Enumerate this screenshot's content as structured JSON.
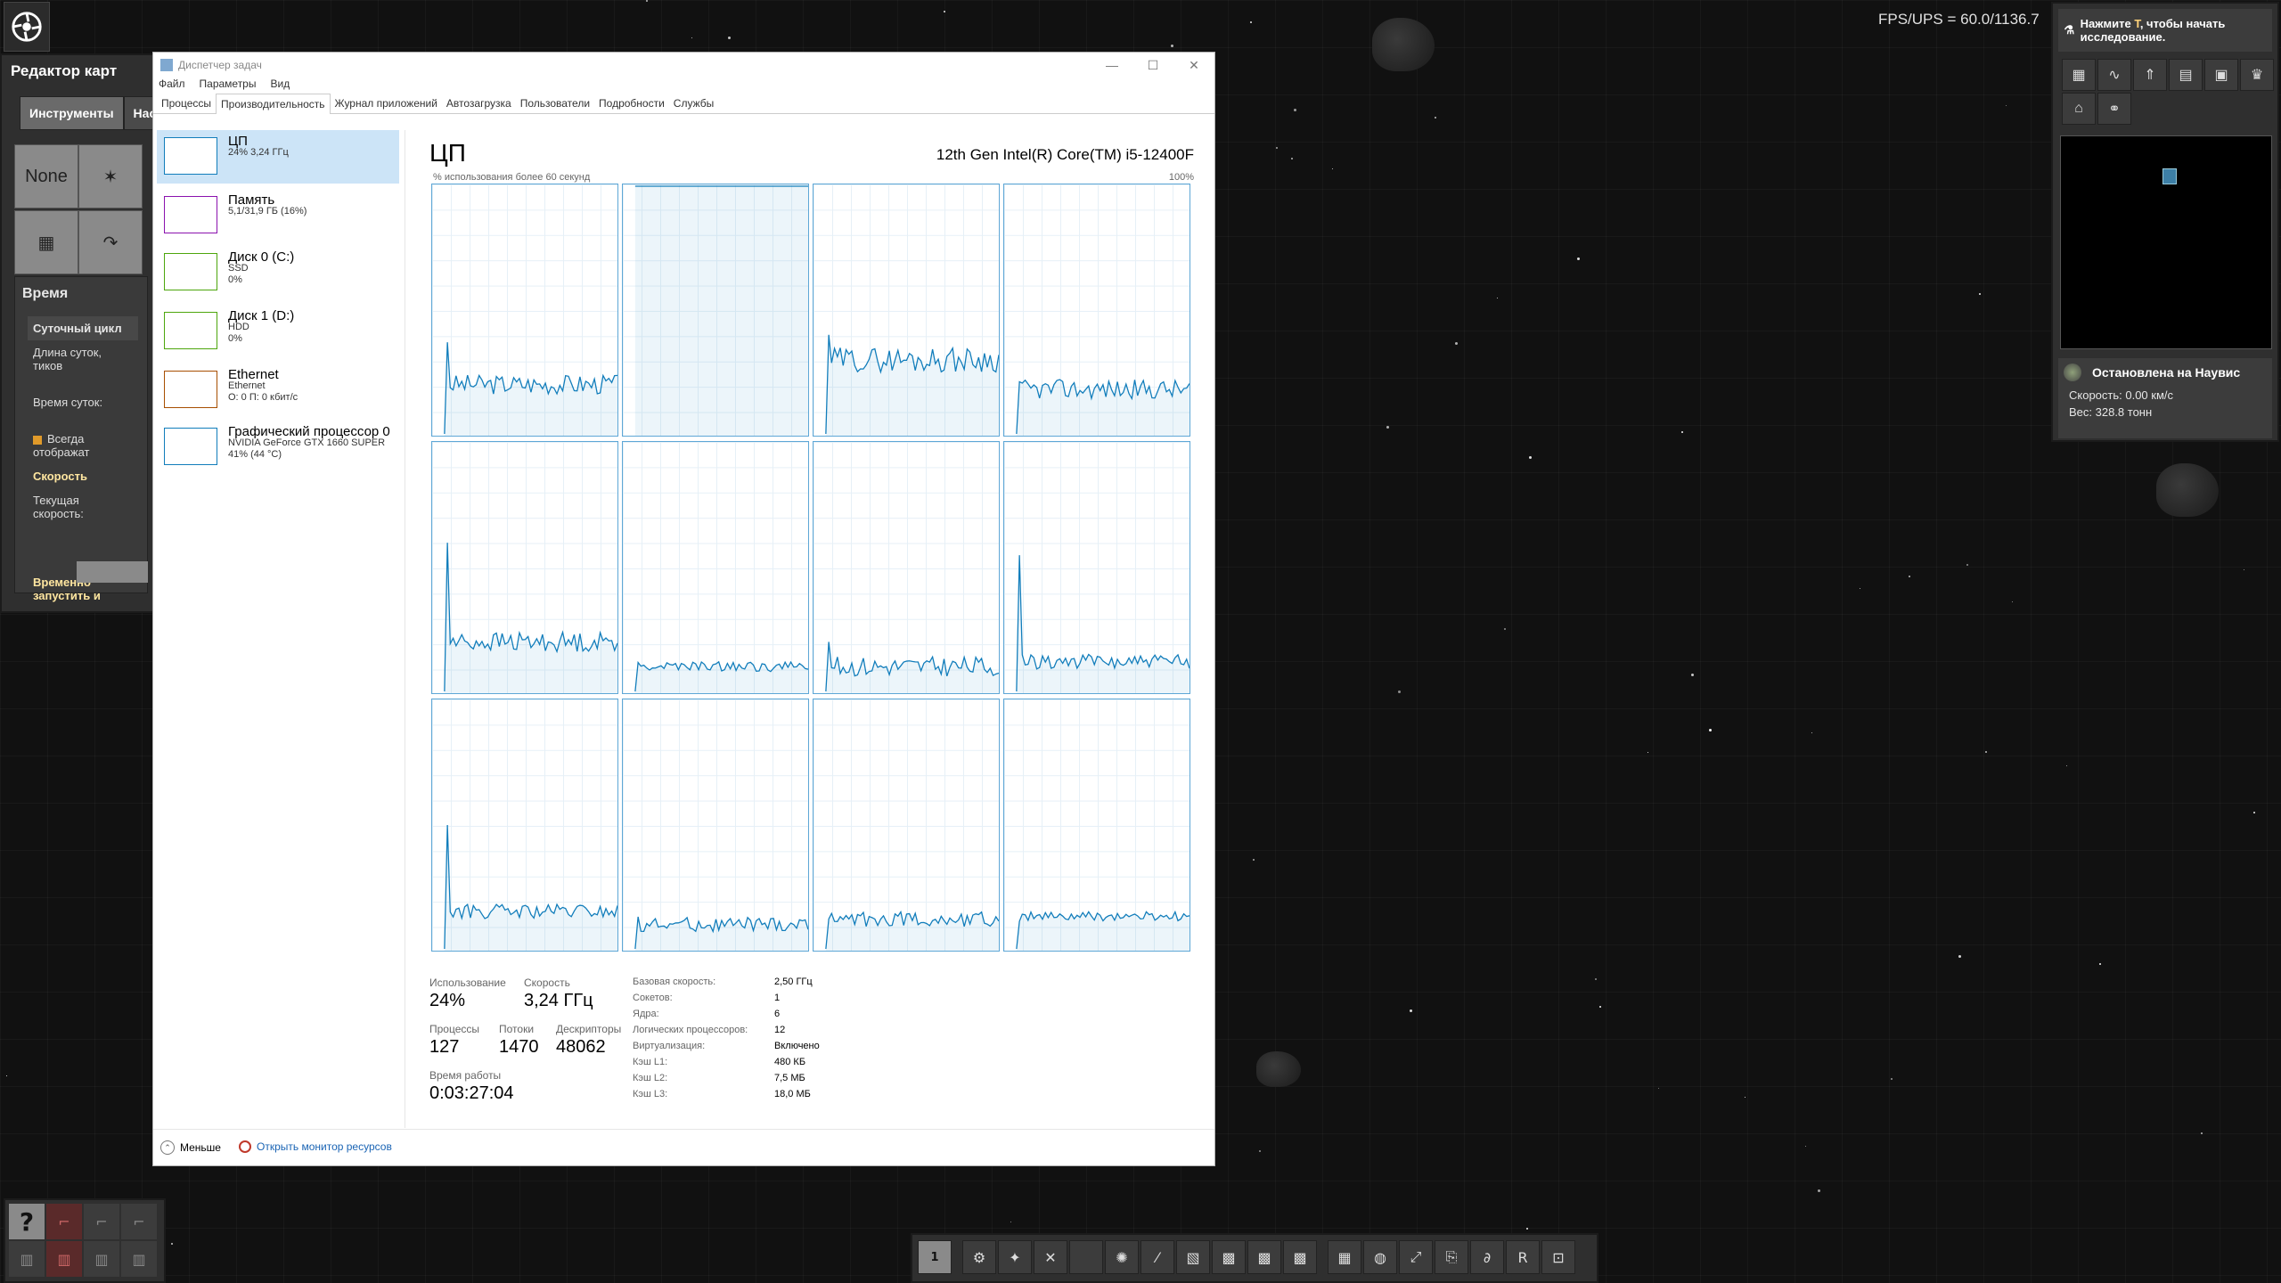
{
  "hud": {
    "fps": "FPS/UPS = 60.0/1136.7"
  },
  "map_editor": {
    "title": "Редактор карт",
    "tabs": [
      "Инструменты",
      "Настр"
    ],
    "tool_none": "None",
    "section_title": "Время",
    "day_cycle": "Суточный цикл",
    "day_length": "Длина суток, тиков",
    "time_of_day": "Время суток:",
    "always_show": "Всегда отображат",
    "speed": "Скорость",
    "current_speed": "Текущая скорость:",
    "temp_run": "Временно запустить и"
  },
  "task_manager": {
    "title": "Диспетчер задач",
    "menu": [
      "Файл",
      "Параметры",
      "Вид"
    ],
    "tabs": [
      "Процессы",
      "Производительность",
      "Журнал приложений",
      "Автозагрузка",
      "Пользователи",
      "Подробности",
      "Службы"
    ],
    "active_tab": "Производительность",
    "sidebar": [
      {
        "name": "ЦП",
        "sub1": "24% 3,24 ГГц",
        "sub2": "",
        "sub3": "",
        "color": "#117dbb"
      },
      {
        "name": "Память",
        "sub1": "5,1/31,9 ГБ (16%)",
        "sub2": "",
        "sub3": "",
        "color": "#8b12ae"
      },
      {
        "name": "Диск 0 (C:)",
        "sub1": "SSD",
        "sub2": "0%",
        "sub3": "",
        "color": "#4da60c"
      },
      {
        "name": "Диск 1 (D:)",
        "sub1": "HDD",
        "sub2": "0%",
        "sub3": "",
        "color": "#4da60c"
      },
      {
        "name": "Ethernet",
        "sub1": "Ethernet",
        "sub2": "О: 0 П: 0 кбит/с",
        "sub3": "",
        "color": "#a74f01"
      },
      {
        "name": "Графический процессор 0",
        "sub1": "NVIDIA GeForce GTX 1660 SUPER",
        "sub2": "41% (44 °C)",
        "sub3": "",
        "color": "#117dbb"
      }
    ],
    "cpu": {
      "title": "ЦП",
      "model": "12th Gen Intel(R) Core(TM) i5-12400F",
      "axis_left": "% использования более 60 секунд",
      "axis_right": "100%",
      "usage_label": "Использование",
      "usage_value": "24%",
      "speed_label": "Скорость",
      "speed_value": "3,24 ГГц",
      "processes_label": "Процессы",
      "processes_value": "127",
      "threads_label": "Потоки",
      "threads_value": "1470",
      "handles_label": "Дескрипторы",
      "handles_value": "48062",
      "uptime_label": "Время работы",
      "uptime_value": "0:03:27:04",
      "details": [
        {
          "k": "Базовая скорость:",
          "v": "2,50 ГГц"
        },
        {
          "k": "Сокетов:",
          "v": "1"
        },
        {
          "k": "Ядра:",
          "v": "6"
        },
        {
          "k": "Логических процессоров:",
          "v": "12"
        },
        {
          "k": "Виртуализация:",
          "v": "Включено"
        },
        {
          "k": "Кэш L1:",
          "v": "480 КБ"
        },
        {
          "k": "Кэш L2:",
          "v": "7,5 МБ"
        },
        {
          "k": "Кэш L3:",
          "v": "18,0 МБ"
        }
      ],
      "core_traces": [
        {
          "spike": 0.37,
          "base": 0.2,
          "noise": 0.04,
          "full": false
        },
        {
          "spike": 0.0,
          "base": 1.0,
          "noise": 0.0,
          "full": true
        },
        {
          "spike": 0.4,
          "base": 0.3,
          "noise": 0.05,
          "full": false
        },
        {
          "spike": 0.0,
          "base": 0.18,
          "noise": 0.04,
          "full": false
        },
        {
          "spike": 0.6,
          "base": 0.2,
          "noise": 0.04,
          "full": false
        },
        {
          "spike": 0.0,
          "base": 0.1,
          "noise": 0.02,
          "full": false
        },
        {
          "spike": 0.2,
          "base": 0.1,
          "noise": 0.04,
          "full": false
        },
        {
          "spike": 0.55,
          "base": 0.12,
          "noise": 0.03,
          "full": false
        },
        {
          "spike": 0.5,
          "base": 0.15,
          "noise": 0.03,
          "full": false
        },
        {
          "spike": 0.0,
          "base": 0.1,
          "noise": 0.03,
          "full": false
        },
        {
          "spike": 0.0,
          "base": 0.12,
          "noise": 0.03,
          "full": false
        },
        {
          "spike": 0.0,
          "base": 0.13,
          "noise": 0.02,
          "full": false
        }
      ]
    },
    "footer_less": "Меньше",
    "footer_resmon": "Открыть монитор ресурсов"
  },
  "right_panel": {
    "research_pre": "Нажмите ",
    "research_key": "T",
    "research_post": ", чтобы начать исследование.",
    "status_title": "Остановлена на Наувис",
    "speed": "Скорость: 0.00 км/с",
    "weight": "Вес: 328.8 тонн"
  },
  "quickbar": {
    "page": "1"
  },
  "colors": {
    "graph_line": "#117dbb",
    "graph_border": "#5ea7d6",
    "selected_bg": "#cce4f7"
  }
}
